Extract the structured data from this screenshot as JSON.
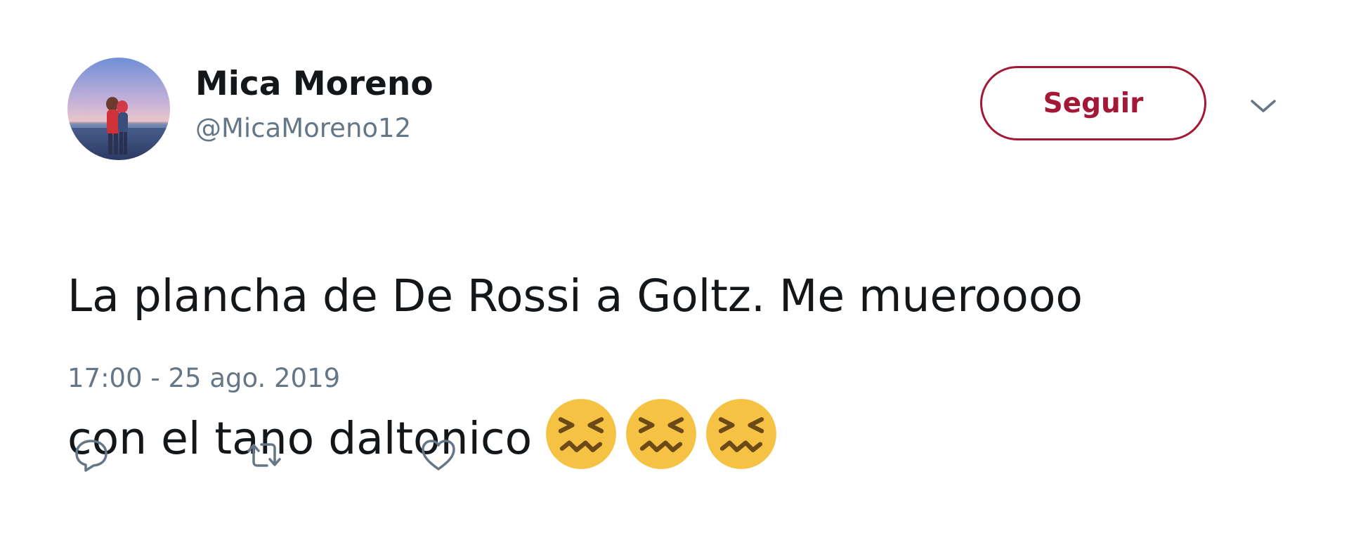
{
  "author": {
    "name": "Mica Moreno",
    "handle": "@MicaMoreno12",
    "avatar_icon": "profile-photo-couple-at-beach"
  },
  "follow_button": {
    "label": "Seguir",
    "color": "#a31837"
  },
  "menu_caret_icon": "chevron-down-icon",
  "tweet": {
    "line1": "La plancha de De Rossi a Goltz. Me mueroooo",
    "line2": "con el tano daltonico",
    "emoji": [
      "confounded-face",
      "confounded-face",
      "confounded-face"
    ],
    "timestamp": "17:00 - 25 ago. 2019"
  },
  "actions": [
    {
      "name": "reply",
      "icon": "reply-icon"
    },
    {
      "name": "retweet",
      "icon": "retweet-icon"
    },
    {
      "name": "like",
      "icon": "heart-icon"
    }
  ],
  "colors": {
    "text_primary": "#14171a",
    "text_secondary": "#657786",
    "emoji_yellow": "#f6c244",
    "emoji_features": "#6b4a17"
  }
}
